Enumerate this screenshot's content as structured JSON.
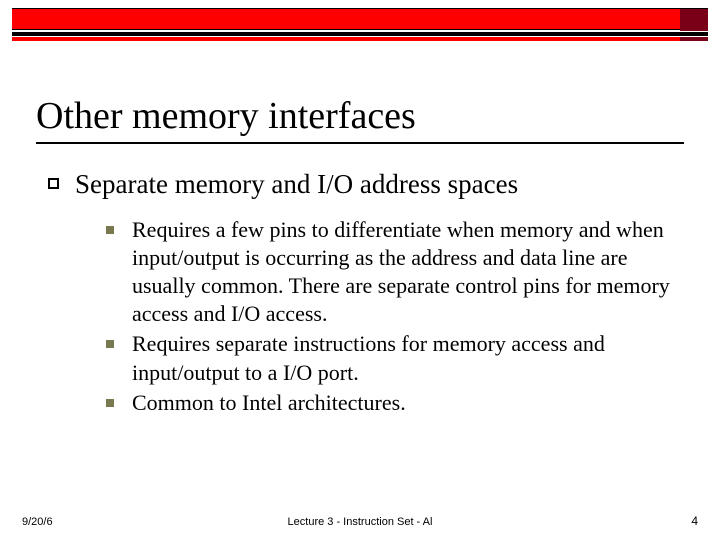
{
  "title": "Other memory interfaces",
  "level1": {
    "text": "Separate memory and I/O address spaces"
  },
  "level2": [
    {
      "text": "Requires a few pins to differentiate when memory and when input/output is occurring as the address and data line are usually common.  There are separate control pins for memory access and I/O access."
    },
    {
      "text": "Requires separate instructions for memory access and input/output to a I/O port."
    },
    {
      "text": "Common to Intel architectures."
    }
  ],
  "footer": {
    "date": "9/20/6",
    "center": "Lecture 3 - Instruction Set - Al",
    "page": "4"
  }
}
